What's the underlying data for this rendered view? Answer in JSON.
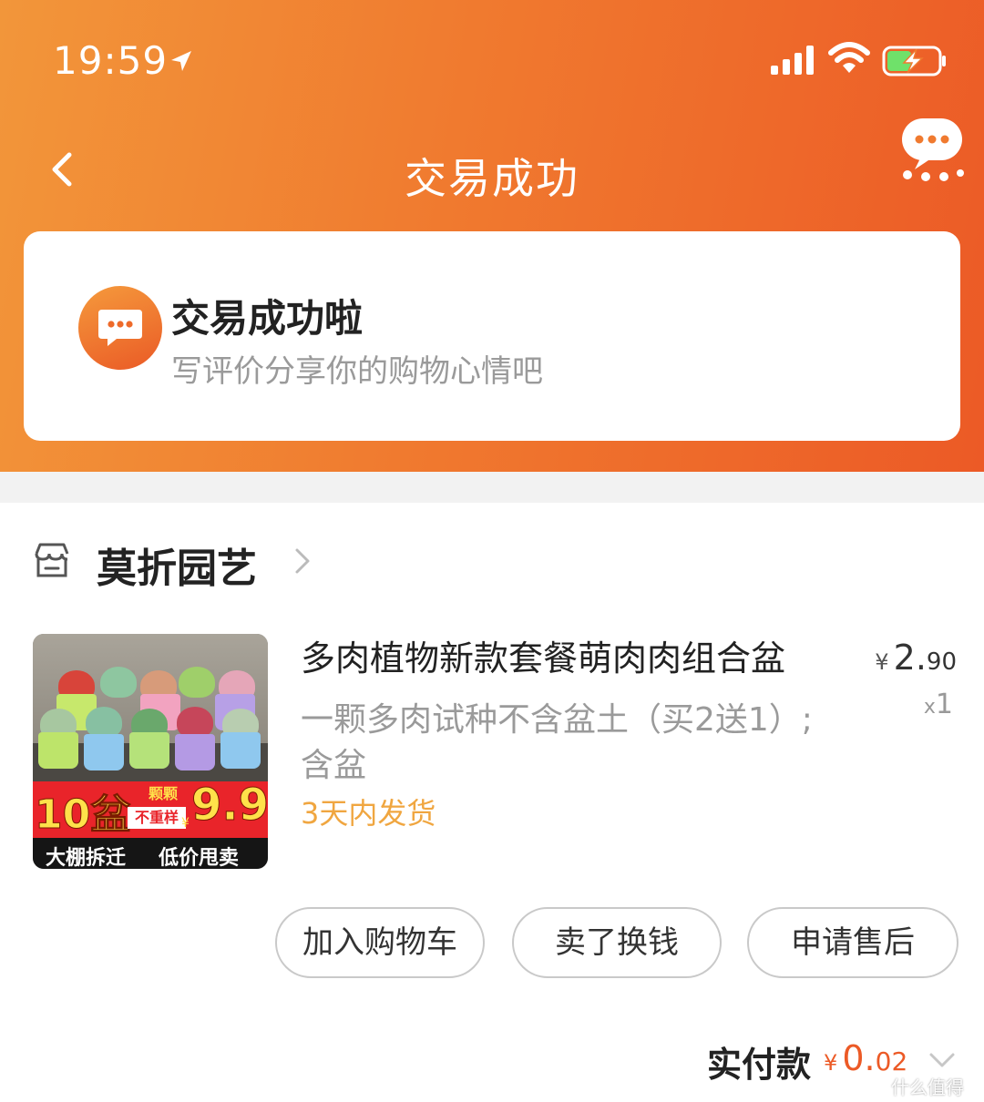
{
  "status_bar": {
    "time": "19:59",
    "icons": [
      "location-arrow-icon",
      "cellular-signal-icon",
      "wifi-icon",
      "battery-charging-icon"
    ]
  },
  "nav": {
    "title": "交易成功",
    "back_icon": "chevron-left-icon",
    "chat_icon": "chat-bubble-icon"
  },
  "success_card": {
    "icon": "chat-bubble-icon",
    "title": "交易成功啦",
    "subtitle": "写评价分享你的购物心情吧"
  },
  "store": {
    "icon": "store-icon",
    "name": "莫折园艺"
  },
  "product": {
    "title": "多肉植物新款套餐萌肉肉组合盆",
    "sku": "一颗多肉试种不含盆土（买2送1）;含盆",
    "shipping": "3天内发货",
    "price_symbol": "¥",
    "price_int": "2.",
    "price_dec": "90",
    "qty_prefix": "x",
    "qty": "1",
    "thumbnail": {
      "big_text": "10盆",
      "tag_top": "颗颗",
      "tag_bottom": "不重样",
      "price_symbol": "¥",
      "price": "9.9",
      "bottom_left": "大棚拆迁",
      "bottom_right": "低价甩卖"
    }
  },
  "actions": {
    "add_to_cart": "加入购物车",
    "sell_for_cash": "卖了换钱",
    "after_sales": "申请售后"
  },
  "payment": {
    "label": "实付款",
    "symbol": "¥",
    "int": "0.",
    "dec": "02"
  },
  "watermark": {
    "text": "什么值得买"
  },
  "colors": {
    "header_start": "#f2963a",
    "header_end": "#ec5a26",
    "accent": "#ec5a26",
    "shipping": "#f0a640"
  }
}
